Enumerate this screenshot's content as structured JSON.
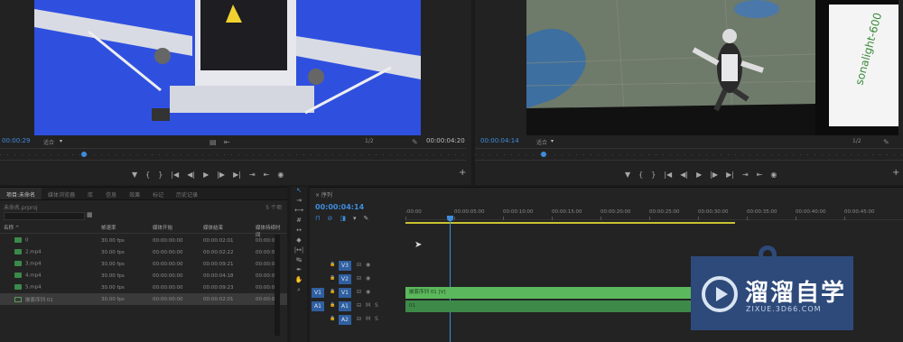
{
  "source_monitor": {
    "timecode_left": "00:00:29",
    "fit": "适合",
    "ratio": "1/2",
    "timecode_right": "00:00:04:20"
  },
  "program_monitor": {
    "timecode_left": "00:00:04:14",
    "fit": "适合",
    "ratio": "1/2",
    "timecode_right": "00:00:04:20",
    "bg_text": "sonalight-600"
  },
  "transport": [
    "▼",
    "{",
    "}",
    "|◀",
    "◀|",
    "▶",
    "|▶",
    "▶|",
    "⇥",
    "⇤",
    "◉"
  ],
  "project": {
    "tabs": [
      "项目:未命名",
      "媒体浏览器",
      "库",
      "信息",
      "效果",
      "标记",
      "历史记录"
    ],
    "path": "未命名.prproj",
    "count": "5 个项",
    "columns": [
      "名称 ^",
      "帧速率",
      "媒体开始",
      "媒体结束",
      "媒体持续时间"
    ],
    "rows": [
      {
        "name": "0",
        "fps": "30.00 fps",
        "start": "00:00:00:00",
        "end": "00:00:02:01",
        "dur": "00:00:02:"
      },
      {
        "name": "2.mp4",
        "fps": "30.00 fps",
        "start": "00:00:00:00",
        "end": "00:00:02:22",
        "dur": "00:00:02:"
      },
      {
        "name": "3.mp4",
        "fps": "30.00 fps",
        "start": "00:00:00:00",
        "end": "00:00:09:21",
        "dur": "00:00:09:"
      },
      {
        "name": "4.mp4",
        "fps": "30.00 fps",
        "start": "00:00:00:00",
        "end": "00:00:04:18",
        "dur": "00:00:04:"
      },
      {
        "name": "5.mp4",
        "fps": "30.00 fps",
        "start": "00:00:00:00",
        "end": "00:00:09:23",
        "dur": "00:00:09:"
      },
      {
        "name": "嵌套序列 01",
        "fps": "30.00 fps",
        "start": "00:00:00:00",
        "end": "00:00:02:01",
        "dur": "00:00:02:"
      }
    ]
  },
  "timeline": {
    "tab": "× 序列",
    "timecode": "00:00:04:14",
    "ruler": [
      ":00:00",
      "00:00:05:00",
      "00:00:10:00",
      "00:00:15:00",
      "00:00:20:00",
      "00:00:25:00",
      "00:00:30:00",
      "00:00:35:00",
      "00:00:40:00",
      "00:00:45:00"
    ],
    "tracks": [
      {
        "name": "V3",
        "src": ""
      },
      {
        "name": "V2",
        "src": ""
      },
      {
        "name": "V1",
        "src": "V1"
      },
      {
        "name": "A1",
        "src": "A1"
      },
      {
        "name": "A2",
        "src": ""
      }
    ],
    "video_clip": "嵌套序列 01 [V]",
    "audio_clip": "01"
  },
  "watermark": {
    "title": "溜溜自学",
    "url": "ZIXUE.3D66.COM"
  },
  "colors": {
    "accent": "#3e8ddd",
    "clip_video": "#5bb85c",
    "clip_audio": "#3d8a48",
    "watermark_bg": "#2d4a7a"
  }
}
